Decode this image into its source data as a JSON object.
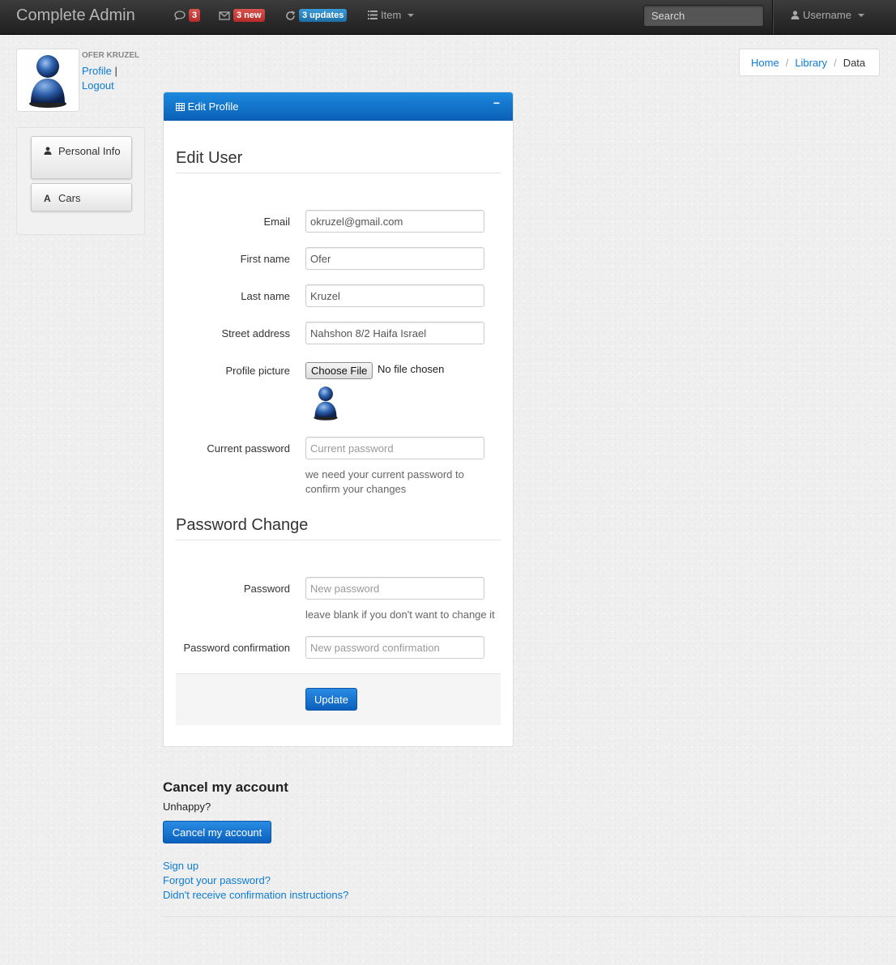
{
  "navbar": {
    "brand": "Complete Admin",
    "comments_badge": "3",
    "messages_badge": "3 new",
    "updates_badge": "3 updates",
    "item_label": "Item",
    "search_placeholder": "Search",
    "username": "Username"
  },
  "profile": {
    "name": "OFER KRUZEL",
    "profile_link": "Profile",
    "separator": "|",
    "logout_link": "Logout"
  },
  "sidebar": {
    "items": [
      {
        "label": "Personal Info",
        "icon": "user-icon"
      },
      {
        "label": "Cars",
        "icon": "car-icon"
      }
    ]
  },
  "breadcrumb": {
    "items": [
      "Home",
      "Library",
      "Data"
    ]
  },
  "panel": {
    "title": "Edit Profile",
    "collapse_symbol": "−",
    "edit_user_heading": "Edit User",
    "password_heading": "Password Change",
    "fields": {
      "email_label": "Email",
      "email_value": "okruzel@gmail.com",
      "first_name_label": "First name",
      "first_name_value": "Ofer",
      "last_name_label": "Last name",
      "last_name_value": "Kruzel",
      "street_label": "Street address",
      "street_value": "Nahshon 8/2 Haifa Israel",
      "picture_label": "Profile picture",
      "choose_file": "Choose File",
      "file_status": "No file chosen",
      "current_password_label": "Current password",
      "current_password_placeholder": "Current password",
      "current_password_help": "we need your current password to confirm your changes",
      "password_label": "Password",
      "password_placeholder": "New password",
      "password_help": "leave blank if you don't want to change it",
      "password_confirmation_label": "Password confirmation",
      "password_confirmation_placeholder": "New password confirmation"
    },
    "update_button": "Update"
  },
  "cancel": {
    "heading": "Cancel my account",
    "text": "Unhappy?",
    "button": "Cancel my account"
  },
  "links": {
    "sign_up": "Sign up",
    "forgot": "Forgot your password?",
    "confirmation": "Didn't receive confirmation instructions?"
  },
  "colors": {
    "navbar": "#2b2b2b",
    "primary": "#0b6fce",
    "badge_red": "#c9302c",
    "badge_blue": "#2a85c5",
    "link": "#0d7bd4"
  }
}
